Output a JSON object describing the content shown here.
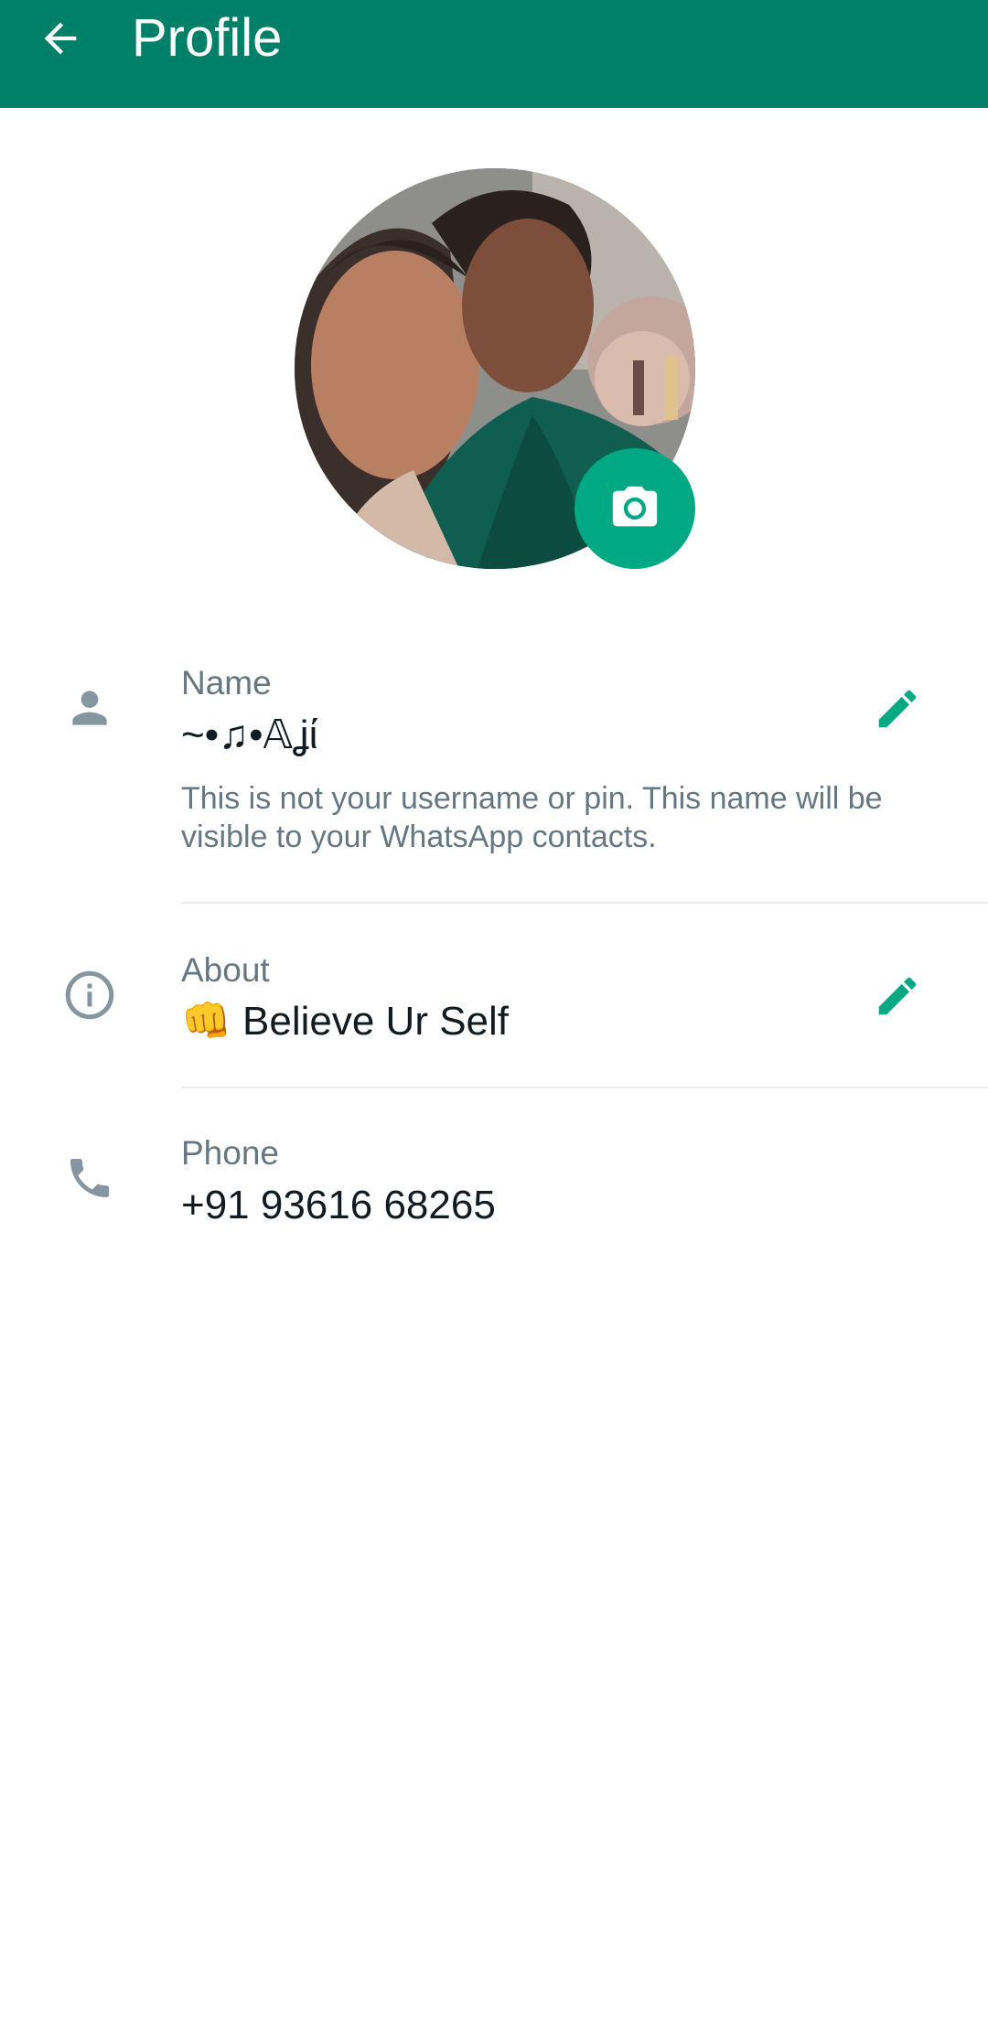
{
  "appbar": {
    "title": "Profile",
    "back_icon": "arrow-back-icon"
  },
  "profile_photo": {
    "camera_icon": "camera-icon",
    "accent": "#00a884"
  },
  "name_section": {
    "label": "Name",
    "value": "~•♫•𝔸ʝί",
    "helper": "This is not your username or pin. This name will be visible to your WhatsApp contacts.",
    "icon": "person-icon",
    "edit_icon": "pencil-icon"
  },
  "about_section": {
    "label": "About",
    "value": "👊 Believe Ur Self",
    "icon": "info-icon",
    "edit_icon": "pencil-icon"
  },
  "phone_section": {
    "label": "Phone",
    "value": "+91 93616 68265",
    "icon": "phone-icon"
  },
  "colors": {
    "appbar": "#008069",
    "accent": "#00a884",
    "secondary_text": "#667781",
    "primary_text": "#111b21"
  }
}
